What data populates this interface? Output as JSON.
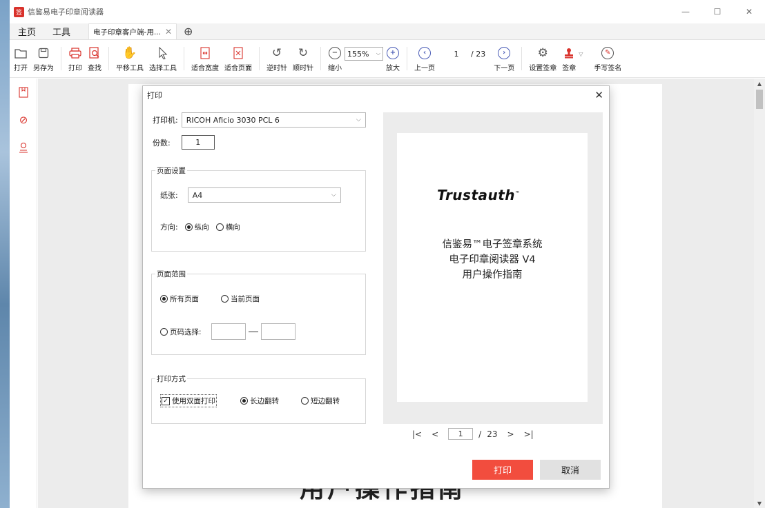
{
  "window": {
    "title": "信鉴易电子印章阅读器",
    "logo_glyph": "签",
    "controls": {
      "minimize": "—",
      "maximize": "☐",
      "close": "✕"
    }
  },
  "tabs": {
    "home": "主页",
    "tools": "工具",
    "document": "电子印章客户端-用...",
    "close_glyph": "✕",
    "add_glyph": "⊕"
  },
  "toolbar": {
    "open": "打开",
    "save_as": "另存为",
    "print": "打印",
    "find": "查找",
    "pan_tool": "平移工具",
    "select_tool": "选择工具",
    "fit_width": "适合宽度",
    "fit_page": "适合页面",
    "rotate_ccw": "逆时针",
    "rotate_cw": "顺时针",
    "zoom_out": "缩小",
    "zoom_value": "155%",
    "zoom_in": "放大",
    "prev_page": "上一页",
    "page_current": "1",
    "page_total": "/ 23",
    "next_page": "下一页",
    "seal_settings": "设置签章",
    "sign": "签章",
    "handwrite_sign": "手写签名"
  },
  "background_doc_text": "用户操作指南",
  "print_dialog": {
    "title": "打印",
    "printer_label": "打印机:",
    "printer_value": "RICOH Aficio 3030 PCL 6",
    "copies_label": "份数:",
    "copies_value": "1",
    "page_setup": {
      "title": "页面设置",
      "paper_label": "纸张:",
      "paper_value": "A4",
      "orientation_label": "方向:",
      "portrait": "纵向",
      "landscape": "横向"
    },
    "page_range": {
      "title": "页面范围",
      "all_pages": "所有页面",
      "current_page": "当前页面",
      "page_select": "页码选择:"
    },
    "print_mode": {
      "title": "打印方式",
      "duplex": "使用双面打印",
      "long_edge": "长边翻转",
      "short_edge": "短边翻转"
    },
    "preview": {
      "logo": "Trustauth",
      "tm": "™",
      "line1": "信鉴易™电子签章系统",
      "line2": "电子印章阅读器 V4",
      "line3": "用户操作指南"
    },
    "preview_nav": {
      "first": "|<",
      "prev": "<",
      "page": "1",
      "separator": "/",
      "total": "23",
      "next": ">",
      "last": ">|"
    },
    "print_button": "打印",
    "cancel_button": "取消"
  },
  "colors": {
    "accent": "#f24d3e",
    "icon_blue": "#4a5cb6",
    "seal_red": "#d9322b"
  }
}
